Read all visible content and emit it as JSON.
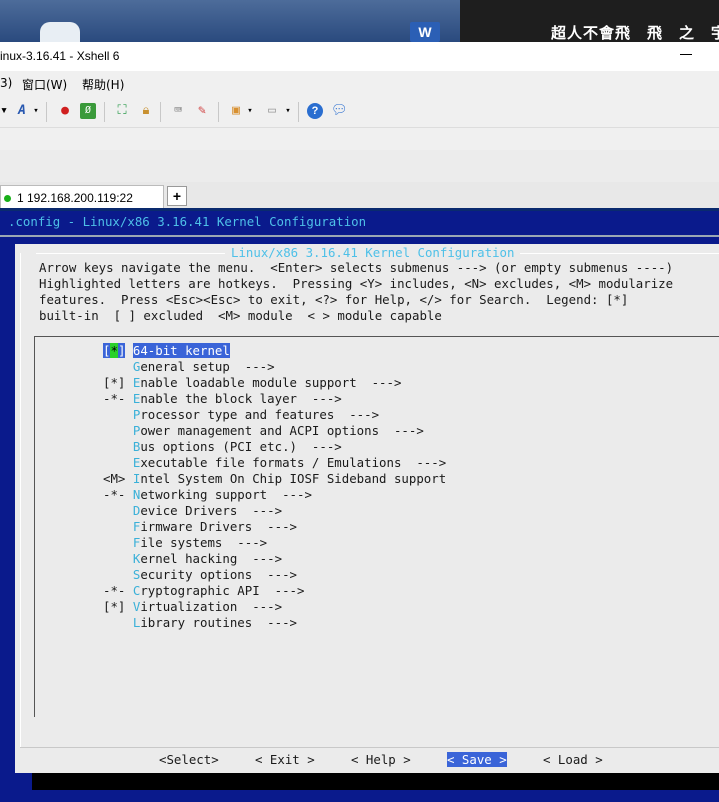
{
  "desktop": {
    "right_text": "超人不會飛　飛　之　宇"
  },
  "window": {
    "title": "inux-3.16.41 - Xshell 6"
  },
  "menubar": {
    "items": [
      "3)",
      "窗口(W)",
      "帮助(H)"
    ]
  },
  "toolbar": {
    "icons": [
      "menu-arrow-icon",
      "font-icon",
      "dropdown-icon",
      "xftp-icon",
      "xshell-icon",
      "fullscreen-icon",
      "lock-icon",
      "keyboard-icon",
      "highlighter-icon",
      "new-session-icon",
      "dropdown-icon",
      "layout-icon",
      "dropdown-icon",
      "help-icon",
      "chat-icon"
    ]
  },
  "tabs": {
    "active": {
      "number": "1",
      "label": "1 192.168.200.119:22",
      "status_color": "#18b018"
    },
    "add_label": "+"
  },
  "terminal": {
    "config_line": ".config - Linux/x86 3.16.41 Kernel Configuration",
    "dialog_title": "Linux/x86 3.16.41 Kernel Configuration",
    "help_lines": [
      "Arrow keys navigate the menu.  <Enter> selects submenus ---> (or empty submenus ----)",
      "Highlighted letters are hotkeys.  Pressing <Y> includes, <N> excludes, <M> modularize",
      "features.  Press <Esc><Esc> to exit, <?> for Help, </> for Search.  Legend: [*]",
      "built-in  [ ] excluded  <M> module  < > module capable"
    ],
    "menu_items": [
      {
        "prefix": "[*]",
        "label": "64-bit kernel",
        "selected": true
      },
      {
        "prefix": "   ",
        "label": "General setup  --->"
      },
      {
        "prefix": "[*]",
        "label": "Enable loadable module support  --->"
      },
      {
        "prefix": "-*-",
        "label": "Enable the block layer  --->"
      },
      {
        "prefix": "   ",
        "label": "Processor type and features  --->"
      },
      {
        "prefix": "   ",
        "label": "Power management and ACPI options  --->"
      },
      {
        "prefix": "   ",
        "label": "Bus options (PCI etc.)  --->"
      },
      {
        "prefix": "   ",
        "label": "Executable file formats / Emulations  --->"
      },
      {
        "prefix": "<M>",
        "label": "Intel System On Chip IOSF Sideband support"
      },
      {
        "prefix": "-*-",
        "label": "Networking support  --->"
      },
      {
        "prefix": "   ",
        "label": "Device Drivers  --->"
      },
      {
        "prefix": "   ",
        "label": "Firmware Drivers  --->"
      },
      {
        "prefix": "   ",
        "label": "File systems  --->"
      },
      {
        "prefix": "   ",
        "label": "Kernel hacking  --->"
      },
      {
        "prefix": "   ",
        "label": "Security options  --->"
      },
      {
        "prefix": "-*-",
        "label": "Cryptographic API  --->"
      },
      {
        "prefix": "[*]",
        "label": "Virtualization  --->"
      },
      {
        "prefix": "   ",
        "label": "Library routines  --->"
      }
    ],
    "buttons": [
      "<Select>",
      "< Exit >",
      "< Help >",
      "< Save >",
      "< Load >"
    ],
    "active_button": "< Save >"
  },
  "colors": {
    "terminal_bg": "#0a1a8c",
    "dialog_bg": "#ebebeb",
    "hotkey": "#3ab0d8",
    "selection": "#3a64d8"
  }
}
